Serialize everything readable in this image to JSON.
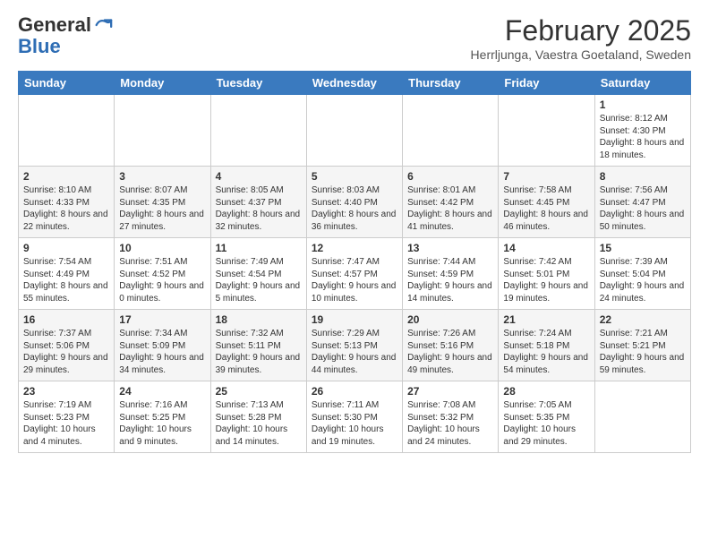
{
  "logo": {
    "general": "General",
    "blue": "Blue"
  },
  "header": {
    "month": "February 2025",
    "location": "Herrljunga, Vaestra Goetaland, Sweden"
  },
  "weekdays": [
    "Sunday",
    "Monday",
    "Tuesday",
    "Wednesday",
    "Thursday",
    "Friday",
    "Saturday"
  ],
  "weeks": [
    [
      {
        "day": "",
        "info": ""
      },
      {
        "day": "",
        "info": ""
      },
      {
        "day": "",
        "info": ""
      },
      {
        "day": "",
        "info": ""
      },
      {
        "day": "",
        "info": ""
      },
      {
        "day": "",
        "info": ""
      },
      {
        "day": "1",
        "info": "Sunrise: 8:12 AM\nSunset: 4:30 PM\nDaylight: 8 hours and 18 minutes."
      }
    ],
    [
      {
        "day": "2",
        "info": "Sunrise: 8:10 AM\nSunset: 4:33 PM\nDaylight: 8 hours and 22 minutes."
      },
      {
        "day": "3",
        "info": "Sunrise: 8:07 AM\nSunset: 4:35 PM\nDaylight: 8 hours and 27 minutes."
      },
      {
        "day": "4",
        "info": "Sunrise: 8:05 AM\nSunset: 4:37 PM\nDaylight: 8 hours and 32 minutes."
      },
      {
        "day": "5",
        "info": "Sunrise: 8:03 AM\nSunset: 4:40 PM\nDaylight: 8 hours and 36 minutes."
      },
      {
        "day": "6",
        "info": "Sunrise: 8:01 AM\nSunset: 4:42 PM\nDaylight: 8 hours and 41 minutes."
      },
      {
        "day": "7",
        "info": "Sunrise: 7:58 AM\nSunset: 4:45 PM\nDaylight: 8 hours and 46 minutes."
      },
      {
        "day": "8",
        "info": "Sunrise: 7:56 AM\nSunset: 4:47 PM\nDaylight: 8 hours and 50 minutes."
      }
    ],
    [
      {
        "day": "9",
        "info": "Sunrise: 7:54 AM\nSunset: 4:49 PM\nDaylight: 8 hours and 55 minutes."
      },
      {
        "day": "10",
        "info": "Sunrise: 7:51 AM\nSunset: 4:52 PM\nDaylight: 9 hours and 0 minutes."
      },
      {
        "day": "11",
        "info": "Sunrise: 7:49 AM\nSunset: 4:54 PM\nDaylight: 9 hours and 5 minutes."
      },
      {
        "day": "12",
        "info": "Sunrise: 7:47 AM\nSunset: 4:57 PM\nDaylight: 9 hours and 10 minutes."
      },
      {
        "day": "13",
        "info": "Sunrise: 7:44 AM\nSunset: 4:59 PM\nDaylight: 9 hours and 14 minutes."
      },
      {
        "day": "14",
        "info": "Sunrise: 7:42 AM\nSunset: 5:01 PM\nDaylight: 9 hours and 19 minutes."
      },
      {
        "day": "15",
        "info": "Sunrise: 7:39 AM\nSunset: 5:04 PM\nDaylight: 9 hours and 24 minutes."
      }
    ],
    [
      {
        "day": "16",
        "info": "Sunrise: 7:37 AM\nSunset: 5:06 PM\nDaylight: 9 hours and 29 minutes."
      },
      {
        "day": "17",
        "info": "Sunrise: 7:34 AM\nSunset: 5:09 PM\nDaylight: 9 hours and 34 minutes."
      },
      {
        "day": "18",
        "info": "Sunrise: 7:32 AM\nSunset: 5:11 PM\nDaylight: 9 hours and 39 minutes."
      },
      {
        "day": "19",
        "info": "Sunrise: 7:29 AM\nSunset: 5:13 PM\nDaylight: 9 hours and 44 minutes."
      },
      {
        "day": "20",
        "info": "Sunrise: 7:26 AM\nSunset: 5:16 PM\nDaylight: 9 hours and 49 minutes."
      },
      {
        "day": "21",
        "info": "Sunrise: 7:24 AM\nSunset: 5:18 PM\nDaylight: 9 hours and 54 minutes."
      },
      {
        "day": "22",
        "info": "Sunrise: 7:21 AM\nSunset: 5:21 PM\nDaylight: 9 hours and 59 minutes."
      }
    ],
    [
      {
        "day": "23",
        "info": "Sunrise: 7:19 AM\nSunset: 5:23 PM\nDaylight: 10 hours and 4 minutes."
      },
      {
        "day": "24",
        "info": "Sunrise: 7:16 AM\nSunset: 5:25 PM\nDaylight: 10 hours and 9 minutes."
      },
      {
        "day": "25",
        "info": "Sunrise: 7:13 AM\nSunset: 5:28 PM\nDaylight: 10 hours and 14 minutes."
      },
      {
        "day": "26",
        "info": "Sunrise: 7:11 AM\nSunset: 5:30 PM\nDaylight: 10 hours and 19 minutes."
      },
      {
        "day": "27",
        "info": "Sunrise: 7:08 AM\nSunset: 5:32 PM\nDaylight: 10 hours and 24 minutes."
      },
      {
        "day": "28",
        "info": "Sunrise: 7:05 AM\nSunset: 5:35 PM\nDaylight: 10 hours and 29 minutes."
      },
      {
        "day": "",
        "info": ""
      }
    ]
  ]
}
